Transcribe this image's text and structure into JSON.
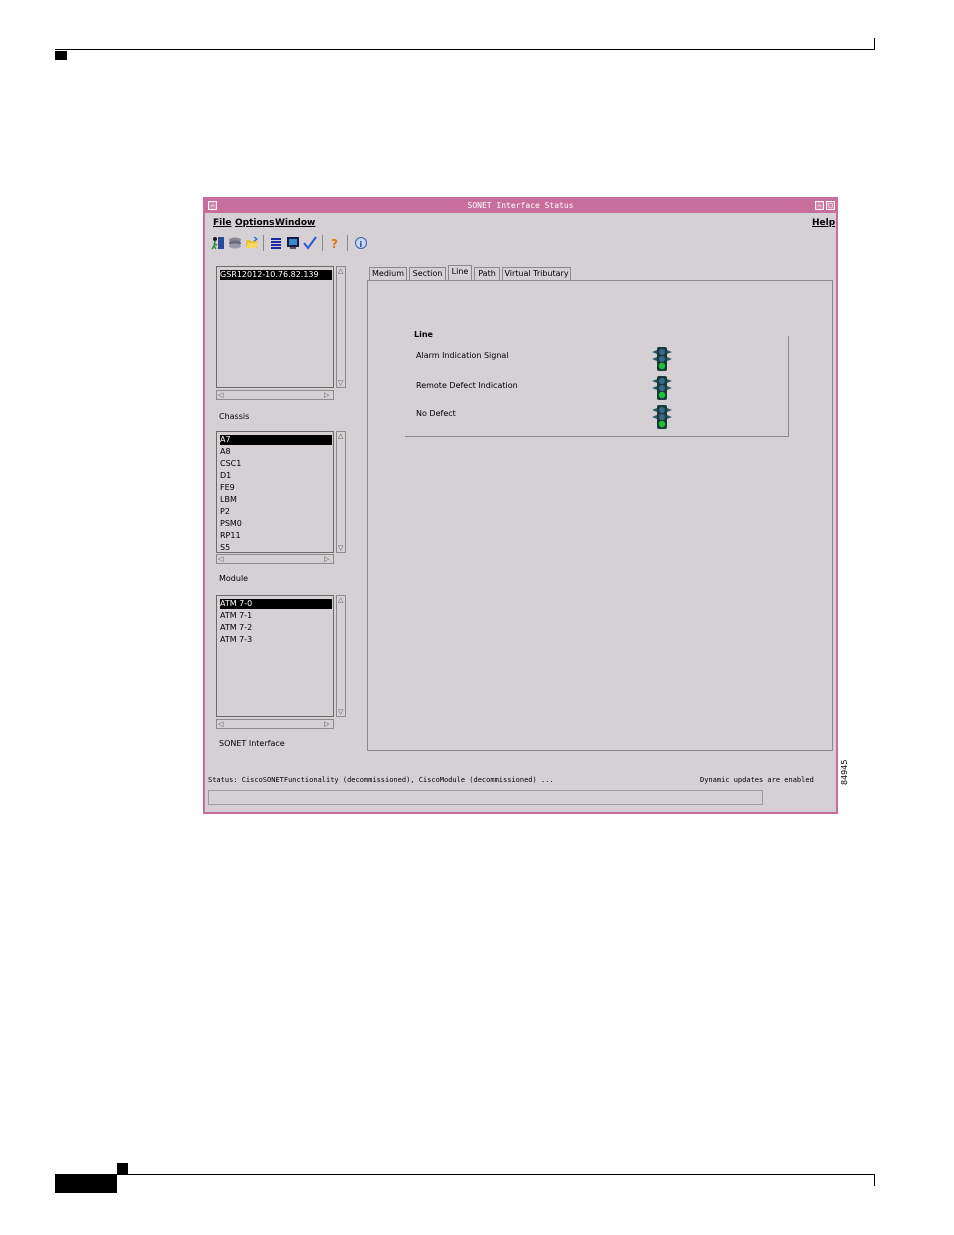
{
  "window": {
    "title": "SONET Interface Status",
    "minimize_glyph": "–",
    "maximize_glyph": "□",
    "restore_glyph": "–"
  },
  "menu": {
    "file": "File",
    "options": "Options",
    "window": "Window",
    "help": "Help"
  },
  "toolbar": {
    "icons": [
      "exit-icon",
      "deploy-icon",
      "open-folder-icon",
      "list-icon",
      "monitor-icon",
      "check-icon",
      "help-icon",
      "info-icon"
    ]
  },
  "chassis": {
    "label": "Chassis",
    "items": [
      "GSR12012-10.76.82.139"
    ],
    "selected_index": 0
  },
  "module": {
    "label": "Module",
    "items": [
      "A7",
      "A8",
      "CSC1",
      "D1",
      "FE9",
      "LBM",
      "P2",
      "PSM0",
      "RP11",
      "S5"
    ],
    "selected_index": 0
  },
  "sonet_interface": {
    "label": "SONET Interface",
    "items": [
      "ATM 7-0",
      "ATM 7-1",
      "ATM 7-2",
      "ATM 7-3"
    ],
    "selected_index": 0
  },
  "tabs": [
    {
      "label": "Medium"
    },
    {
      "label": "Section"
    },
    {
      "label": "Line"
    },
    {
      "label": "Path"
    },
    {
      "label": "Virtual Tributary"
    }
  ],
  "active_tab": "Line",
  "line_group": {
    "title": "Line",
    "rows": [
      {
        "label": "Alarm Indication Signal",
        "status_color": "#22c03a"
      },
      {
        "label": "Remote Defect Indication",
        "status_color": "#22c03a"
      },
      {
        "label": "No Defect",
        "status_color": "#22c03a"
      }
    ]
  },
  "status": {
    "text": "Status: CiscoSONETFunctionality (decommissioned), CiscoModule (decommissioned) ...",
    "updates": "Dynamic updates are enabled"
  },
  "figure_number": "84945",
  "colors": {
    "titlebar": "#c86e9a",
    "window_bg": "#d4d0d4"
  }
}
